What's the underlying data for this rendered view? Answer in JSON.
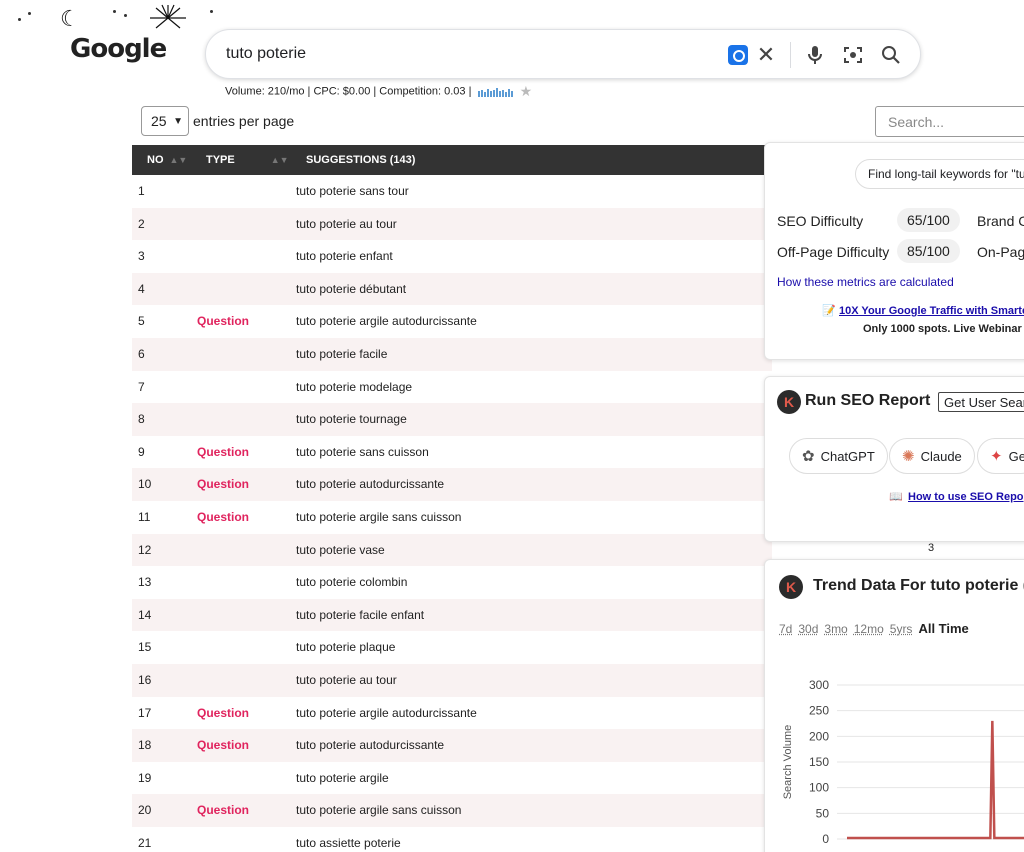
{
  "header": {
    "logo_text": "Google",
    "search_query": "tuto poterie",
    "metrics_line": "Volume: 210/mo | CPC: $0.00 | Competition: 0.03 |"
  },
  "table_controls": {
    "entries_value": "25",
    "entries_label": "entries per page",
    "search_placeholder": "Search..."
  },
  "table": {
    "headers": {
      "no": "NO",
      "type": "TYPE",
      "suggestions": "SUGGESTIONS (143)"
    },
    "rows": [
      {
        "no": "1",
        "type": "",
        "suggestion": "tuto poterie sans tour"
      },
      {
        "no": "2",
        "type": "",
        "suggestion": "tuto poterie au tour"
      },
      {
        "no": "3",
        "type": "",
        "suggestion": "tuto poterie enfant"
      },
      {
        "no": "4",
        "type": "",
        "suggestion": "tuto poterie débutant"
      },
      {
        "no": "5",
        "type": "Question",
        "suggestion": "tuto poterie argile autodurcissante"
      },
      {
        "no": "6",
        "type": "",
        "suggestion": "tuto poterie facile"
      },
      {
        "no": "7",
        "type": "",
        "suggestion": "tuto poterie modelage"
      },
      {
        "no": "8",
        "type": "",
        "suggestion": "tuto poterie tournage"
      },
      {
        "no": "9",
        "type": "Question",
        "suggestion": "tuto poterie sans cuisson"
      },
      {
        "no": "10",
        "type": "Question",
        "suggestion": "tuto poterie autodurcissante"
      },
      {
        "no": "11",
        "type": "Question",
        "suggestion": "tuto poterie argile sans cuisson"
      },
      {
        "no": "12",
        "type": "",
        "suggestion": "tuto poterie vase"
      },
      {
        "no": "13",
        "type": "",
        "suggestion": "tuto poterie colombin"
      },
      {
        "no": "14",
        "type": "",
        "suggestion": "tuto poterie facile enfant"
      },
      {
        "no": "15",
        "type": "",
        "suggestion": "tuto poterie plaque"
      },
      {
        "no": "16",
        "type": "",
        "suggestion": "tuto poterie au tour"
      },
      {
        "no": "17",
        "type": "Question",
        "suggestion": "tuto poterie argile autodurcissante"
      },
      {
        "no": "18",
        "type": "Question",
        "suggestion": "tuto poterie autodurcissante"
      },
      {
        "no": "19",
        "type": "",
        "suggestion": "tuto poterie argile"
      },
      {
        "no": "20",
        "type": "Question",
        "suggestion": "tuto poterie argile sans cuisson"
      },
      {
        "no": "21",
        "type": "",
        "suggestion": "tuto assiette poterie"
      }
    ]
  },
  "seo_panel": {
    "longtail_button": "Find long-tail keywords for \"tu",
    "seo_difficulty_label": "SEO Difficulty",
    "seo_difficulty_value": "65/100",
    "brand_label": "Brand C",
    "offpage_label": "Off-Page Difficulty",
    "offpage_value": "85/100",
    "onpage_label": "On-Pag",
    "how_link": "How these metrics are calculated",
    "promo_link": "10X Your Google Traffic with Smarte",
    "promo_sub": "Only 1000 spots. Live Webinar"
  },
  "report_panel": {
    "title": "Run SEO Report",
    "user_button": "Get User Sear",
    "ai_buttons": [
      "ChatGPT",
      "Claude",
      "Ge"
    ],
    "howto_link": "How to use SEO Repo"
  },
  "page_indicator": "3",
  "trend_panel": {
    "title": "Trend Data For tuto poterie (",
    "ranges": [
      "7d",
      "30d",
      "3mo",
      "12mo",
      "5yrs",
      "All Time"
    ],
    "active_range": "All Time"
  },
  "chart_data": {
    "type": "line",
    "ylabel": "Search Volume",
    "ylim": [
      0,
      300
    ],
    "yticks": [
      0,
      50,
      100,
      150,
      200,
      250,
      300
    ],
    "series": [
      {
        "values": [
          2,
          2,
          2,
          2,
          2,
          2,
          2,
          2,
          2,
          2,
          2,
          2,
          2,
          2,
          2,
          2,
          230,
          2,
          2,
          2,
          2,
          2,
          2,
          2,
          2
        ]
      }
    ],
    "color": "#c0504d"
  },
  "colors": {
    "question": "#e0245e",
    "table_header": "#333333",
    "row_alt": "#f9f2f2",
    "link": "#1a0dab",
    "lens_blue": "#1a73e8"
  }
}
